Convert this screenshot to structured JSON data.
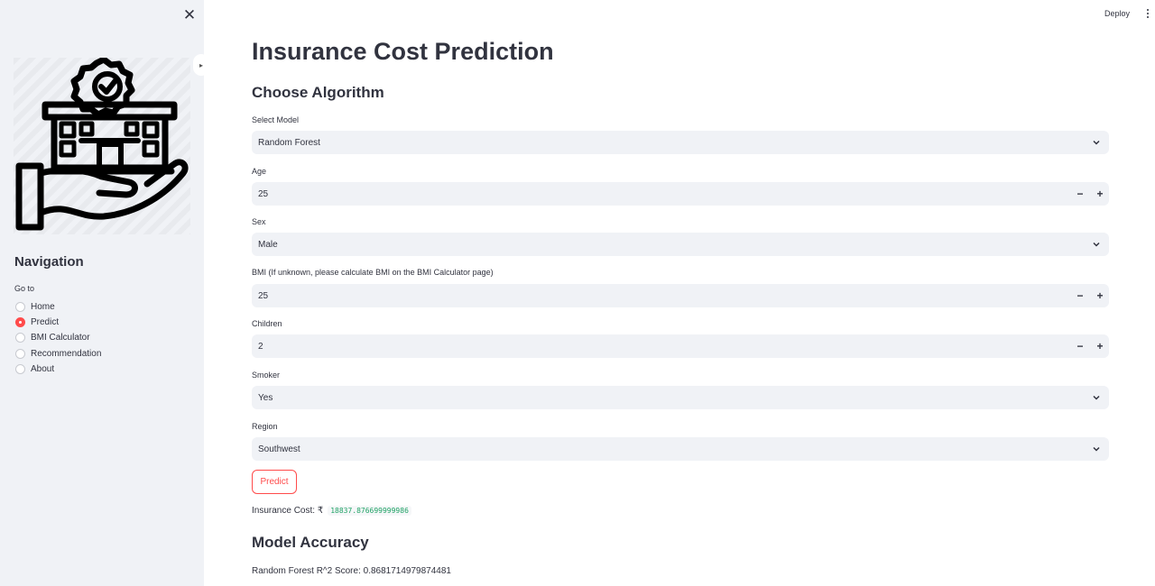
{
  "sidebar": {
    "logo_icon": "insurance-building-hand-icon",
    "nav_title": "Navigation",
    "goto_label": "Go to",
    "items": [
      {
        "label": "Home",
        "selected": false
      },
      {
        "label": "Predict",
        "selected": true
      },
      {
        "label": "BMI Calculator",
        "selected": false
      },
      {
        "label": "Recommendation",
        "selected": false
      },
      {
        "label": "About",
        "selected": false
      }
    ]
  },
  "header": {
    "deploy_label": "Deploy"
  },
  "main": {
    "title": "Insurance Cost Prediction",
    "algorithm_heading": "Choose Algorithm",
    "fields": {
      "model": {
        "label": "Select Model",
        "value": "Random Forest"
      },
      "age": {
        "label": "Age",
        "value": "25"
      },
      "sex": {
        "label": "Sex",
        "value": "Male"
      },
      "bmi": {
        "label": "BMI (If unknown, please calculate BMI on the BMI Calculator page)",
        "value": "25"
      },
      "children": {
        "label": "Children",
        "value": "2"
      },
      "smoker": {
        "label": "Smoker",
        "value": "Yes"
      },
      "region": {
        "label": "Region",
        "value": "Southwest"
      }
    },
    "predict_label": "Predict",
    "cost_label": "Insurance Cost: ₹",
    "cost_value": "18837.876699999986",
    "accuracy_heading": "Model Accuracy",
    "score_text": "Random Forest R^2 Score: 0.8681714979874481"
  },
  "colors": {
    "accent": "#ff4b4b",
    "sidebar_bg": "#f0f2f6",
    "input_bg": "#f0f2f6",
    "code_green": "#21a366",
    "text": "#31333f"
  }
}
